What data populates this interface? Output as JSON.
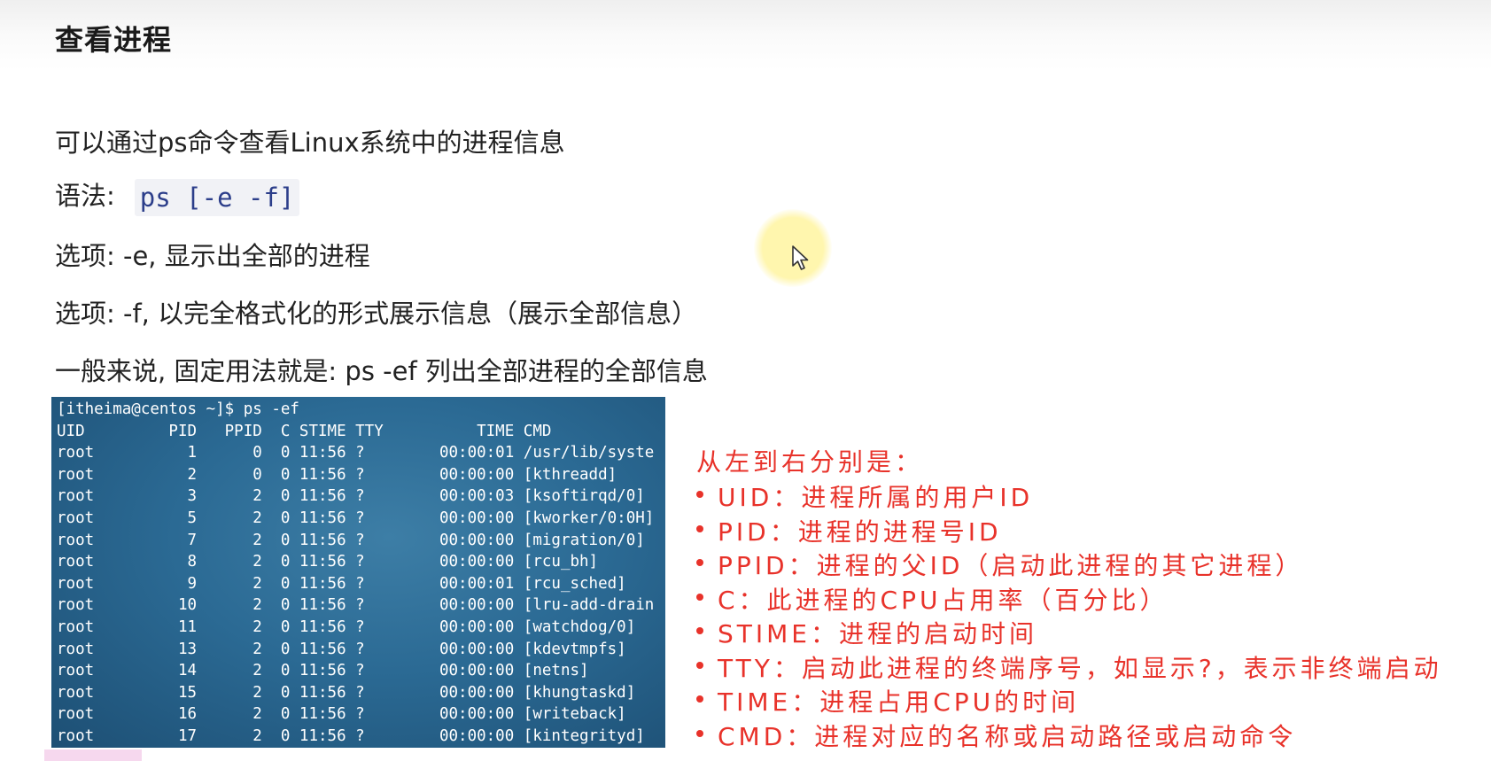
{
  "title": "查看进程",
  "lines": {
    "intro": "可以通过ps命令查看Linux系统中的进程信息",
    "syntax_label": "语法:",
    "syntax_code": "ps [-e -f]",
    "option_e": "选项: -e, 显示出全部的进程",
    "option_f": "选项: -f, 以完全格式化的形式展示信息（展示全部信息）",
    "usage": "一般来说, 固定用法就是: ps -ef 列出全部进程的全部信息"
  },
  "terminal": {
    "rows": [
      "[itheima@centos ~]$ ps -ef",
      "UID         PID   PPID  C STIME TTY          TIME CMD",
      "root          1      0  0 11:56 ?        00:00:01 /usr/lib/syste",
      "root          2      0  0 11:56 ?        00:00:00 [kthreadd]",
      "root          3      2  0 11:56 ?        00:00:03 [ksoftirqd/0]",
      "root          5      2  0 11:56 ?        00:00:00 [kworker/0:0H]",
      "root          7      2  0 11:56 ?        00:00:00 [migration/0]",
      "root          8      2  0 11:56 ?        00:00:00 [rcu_bh]",
      "root          9      2  0 11:56 ?        00:00:01 [rcu_sched]",
      "root         10      2  0 11:56 ?        00:00:00 [lru-add-drain",
      "root         11      2  0 11:56 ?        00:00:00 [watchdog/0]",
      "root         13      2  0 11:56 ?        00:00:00 [kdevtmpfs]",
      "root         14      2  0 11:56 ?        00:00:00 [netns]",
      "root         15      2  0 11:56 ?        00:00:00 [khungtaskd]",
      "root         16      2  0 11:56 ?        00:00:00 [writeback]",
      "root         17      2  0 11:56 ?        00:00:00 [kintegrityd]"
    ]
  },
  "notes": {
    "heading": "从左到右分别是：",
    "items": [
      "UID：进程所属的用户ID",
      "PID：进程的进程号ID",
      "PPID：进程的父ID（启动此进程的其它进程）",
      "C：此进程的CPU占用率（百分比）",
      "STIME：进程的启动时间",
      "TTY：启动此进程的终端序号，如显示?，表示非终端启动",
      "TIME：进程占用CPU的时间",
      "CMD：进程对应的名称或启动路径或启动命令"
    ]
  },
  "colors": {
    "note_red": "#e8322a",
    "code_blue": "#2c3e8a",
    "terminal_bg": "#2b6a94"
  },
  "icons": {
    "cursor": "mouse-pointer-icon"
  }
}
